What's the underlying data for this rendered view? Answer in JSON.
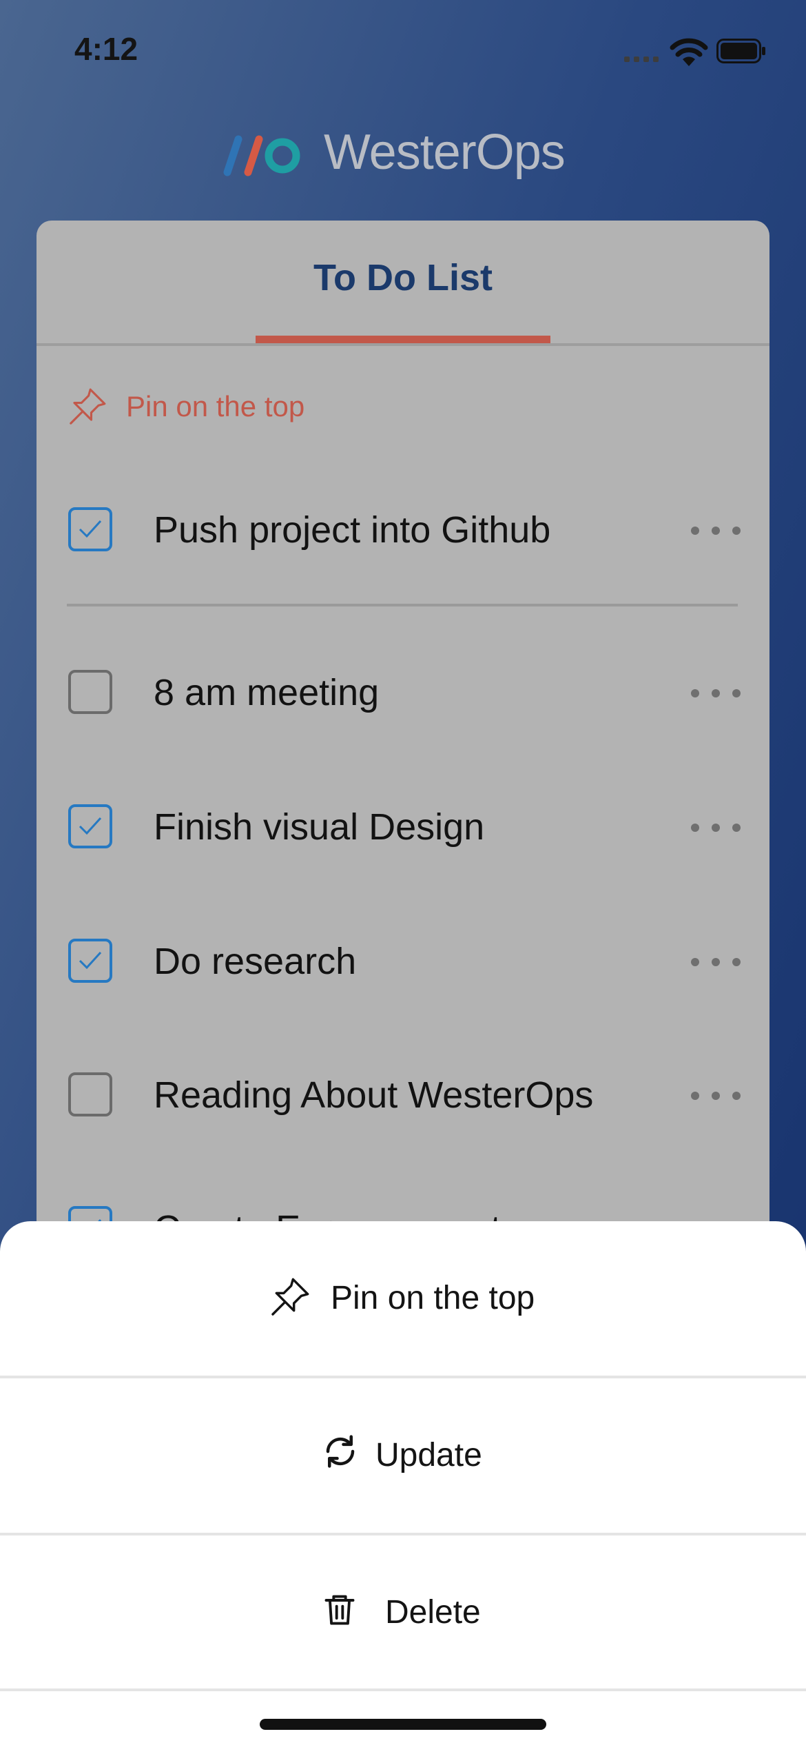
{
  "status_bar": {
    "time": "4:12"
  },
  "brand": {
    "name": "WesterOps"
  },
  "tab": {
    "label": "To Do List"
  },
  "pinned": {
    "label": "Pin on the top"
  },
  "tasks": [
    {
      "label": "Push project into Github",
      "checked": true
    },
    {
      "label": "8 am meeting",
      "checked": false
    },
    {
      "label": "Finish visual Design",
      "checked": true
    },
    {
      "label": "Do research",
      "checked": true
    },
    {
      "label": "Reading About WesterOps",
      "checked": false
    },
    {
      "label": "Create Expo account",
      "checked": true
    }
  ],
  "action_sheet": {
    "pin_label": "Pin on the top",
    "update_label": "Update",
    "delete_label": "Delete"
  },
  "colors": {
    "accent": "#c2584a",
    "checkbox_blue": "#2679c2",
    "title_blue": "#1b3a6b"
  },
  "icons": [
    "pin-icon",
    "refresh-icon",
    "trash-icon",
    "more-icon",
    "check-icon",
    "wifi-icon",
    "battery-icon"
  ]
}
